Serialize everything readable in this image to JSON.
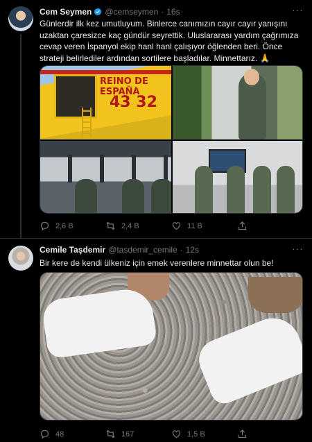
{
  "tweet1": {
    "name": "Cem Seymen",
    "handle": "@cemseymen",
    "dot": "·",
    "time": "16s",
    "text": "Günlerdir ilk kez umutluyum. Binlerce canımızın cayır cayır yanışını uzaktan çaresizce kaç gündür seyrettik. Uluslararası yardım çağrımıza cevap veren İspanyol ekip hanl hanl çalışıyor öğlenden beri. Önce strateji belirlediler ardından sortilere başladılar. Minnettarız. 🙏",
    "photo_text": {
      "line1": "REINO DE ESPAÑA",
      "line2": "43 32"
    },
    "actions": {
      "reply": "2,6 B",
      "retweet": "2,4 B",
      "like": "11 B"
    }
  },
  "tweet2": {
    "name": "Cemile Taşdemir",
    "handle": "@tasdemir_cemile",
    "dot": "·",
    "time": "12s",
    "text": "Bir kere de kendi ülkeniz için emek verenlere minnettar olun be!",
    "actions": {
      "reply": "48",
      "retweet": "167",
      "like": "1,5 B"
    }
  },
  "colors": {
    "background": "#000000",
    "text": "#e7e9ea",
    "muted": "#71767b",
    "verified": "#1d9bf0",
    "border": "#2f3336"
  },
  "icons": [
    "verified-badge-icon",
    "more-icon",
    "reply-icon",
    "retweet-icon",
    "like-icon",
    "share-icon"
  ]
}
